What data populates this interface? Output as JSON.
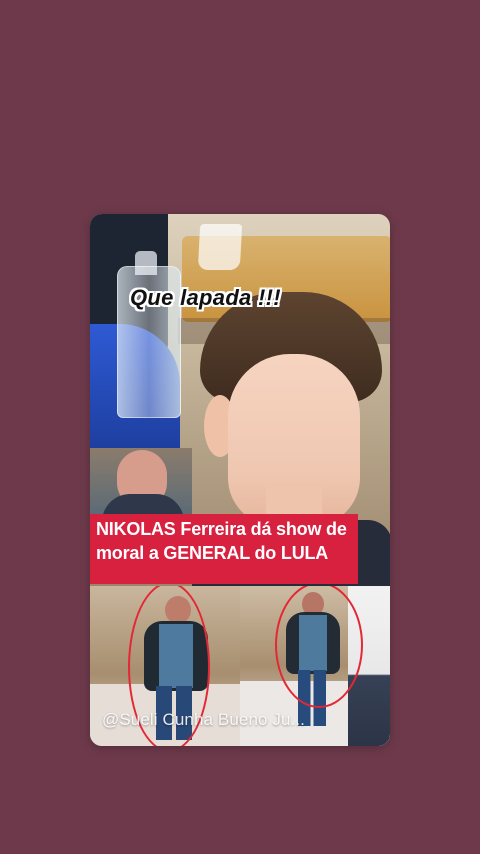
{
  "story": {
    "overlay_text": "Que lapada !!!",
    "headline_line_1": "NIKOLAS Ferreira dá show de",
    "headline_line_2": "moral a GENERAL do LULA",
    "watermark": "@Sueli Cunha Bueno Ju..."
  },
  "colors": {
    "background": "#6e3a4b",
    "headline_bg": "#d8203f",
    "highlight_circle": "#e32735"
  }
}
